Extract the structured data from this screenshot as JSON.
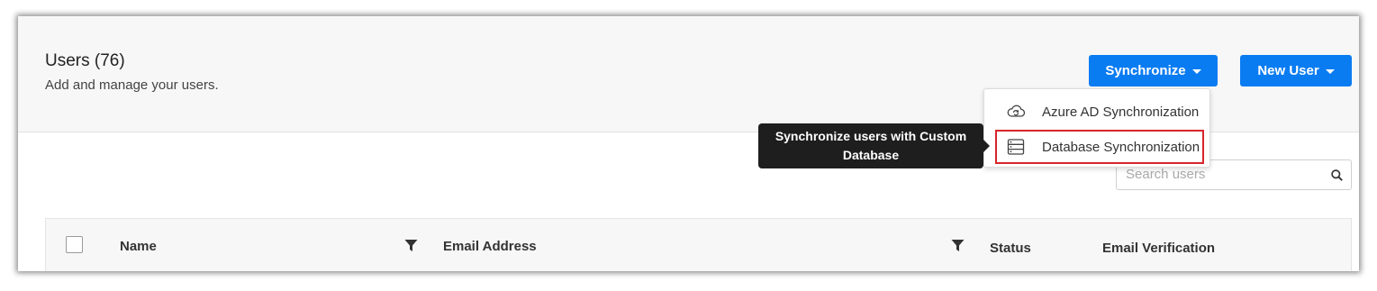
{
  "header": {
    "title": "Users (76)",
    "subtitle": "Add and manage your users."
  },
  "toolbar": {
    "synchronize_label": "Synchronize",
    "new_user_label": "New User"
  },
  "sync_menu": {
    "items": [
      {
        "label": "Azure AD Synchronization",
        "icon": "cloud-sync-icon"
      },
      {
        "label": "Database Synchronization",
        "icon": "database-icon"
      }
    ]
  },
  "tooltip": {
    "text": "Synchronize users with Custom Database"
  },
  "search": {
    "placeholder": "Search users",
    "value": ""
  },
  "table": {
    "columns": [
      "Name",
      "Email Address",
      "Status",
      "Email Verification"
    ]
  },
  "colors": {
    "primary": "#0a7cf2",
    "highlight_border": "#d9252b",
    "tooltip_bg": "#1e1e1e",
    "header_bg": "#f7f7f7"
  }
}
